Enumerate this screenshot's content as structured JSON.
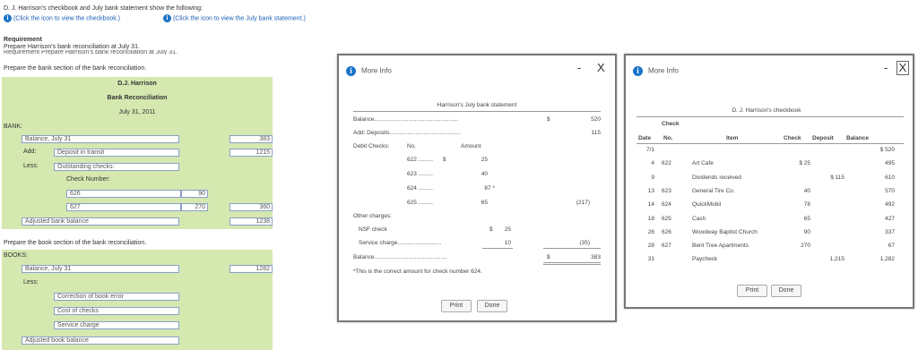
{
  "intro": {
    "line1": "D. J. Harrison's checkbook and July bank statement show the following:",
    "link1": "(Click the icon to view the checkbook.)",
    "link2": "(Click the icon to view the July bank statement.)",
    "req_label": "Requirement",
    "req_text": "Prepare Harrison's bank reconciliation at July 31.",
    "req_cut": "Requirement Prepare Harrison's bank reconciliation at July 31.",
    "bank_section_prompt": "Prepare the bank section of the bank reconciliation.",
    "book_section_prompt": "Prepare the book section of the bank reconciliation."
  },
  "worksheet": {
    "company": "D.J. Harrison",
    "title": "Bank Reconciliation",
    "date": "July 31, 2011",
    "bank_label": "BANK:",
    "balance_label": "Balance, July 31",
    "balance_value": "383",
    "add_label": "Add:",
    "deposit_label": "Deposit in transit",
    "deposit_value": "1215",
    "less_label": "Less:",
    "outstanding_label": "Outstanding checks:",
    "check_number_label": "Check Number:",
    "checks": [
      {
        "number": "626",
        "amount": "90"
      },
      {
        "number": "627",
        "amount": "270"
      }
    ],
    "checks_total": "360",
    "adjusted_bank_label": "Adjusted bank balance",
    "adjusted_bank_value": "1238",
    "books_label": "BOOKS:",
    "book_balance_label": "Balance, July 31",
    "book_balance_value": "1282",
    "book_less_label": "Less:",
    "book_less_items": [
      "Correction of book error",
      "Cost of checks",
      "Service charge"
    ],
    "adjusted_book_label": "Adjusted book balance"
  },
  "bank_window": {
    "title": "More Info",
    "minimize": "-",
    "close": "X",
    "statement_title": "Harrison's July bank statement",
    "balance_label": "Balance",
    "balance_currency": "$",
    "balance_value": "520",
    "deposits_label": "Add: Deposits",
    "deposits_value": "115",
    "debit_label": "Debit Checks:",
    "no_header": "No.",
    "amount_header": "Amount",
    "checks": [
      {
        "no": "622",
        "currency": "$",
        "amount": "25"
      },
      {
        "no": "623",
        "currency": "",
        "amount": "40"
      },
      {
        "no": "624",
        "currency": "",
        "amount": "87 *"
      },
      {
        "no": "625",
        "currency": "",
        "amount": "65"
      }
    ],
    "checks_total": "(217)",
    "other_label": "Other charges:",
    "nsf_label": "NSF check",
    "nsf_currency": "$",
    "nsf_value": "25",
    "service_label": "Service charge",
    "service_value": "10",
    "other_total": "(35)",
    "end_label": "Balance",
    "end_currency": "$",
    "end_value": "383",
    "footnote": "*This is the correct amount for check number 624.",
    "print": "Print",
    "done": "Done"
  },
  "check_window": {
    "title": "More Info",
    "minimize": "-",
    "close": "X",
    "table_title": "D. J. Harrison's checkbook",
    "check_header": "Check",
    "headers": [
      "Date",
      "No.",
      "Item",
      "Check",
      "Deposit",
      "Balance"
    ],
    "rows": [
      {
        "date": "7/1",
        "no": "",
        "item": "",
        "check": "",
        "deposit": "",
        "balance": "$     520"
      },
      {
        "date": "4",
        "no": "622",
        "item": "Art Cafe",
        "check": "$      25",
        "deposit": "",
        "balance": "495"
      },
      {
        "date": "9",
        "no": "",
        "item": "Dividends received",
        "check": "",
        "deposit": "$     115",
        "balance": "610"
      },
      {
        "date": "13",
        "no": "623",
        "item": "General Tire Co.",
        "check": "40",
        "deposit": "",
        "balance": "570"
      },
      {
        "date": "14",
        "no": "624",
        "item": "QuickMobil",
        "check": "78",
        "deposit": "",
        "balance": "492"
      },
      {
        "date": "18",
        "no": "625",
        "item": "Cash",
        "check": "65",
        "deposit": "",
        "balance": "427"
      },
      {
        "date": "26",
        "no": "626",
        "item": "Woodway Baptist Church",
        "check": "90",
        "deposit": "",
        "balance": "337"
      },
      {
        "date": "28",
        "no": "627",
        "item": "Bent Tree Apartments",
        "check": "270",
        "deposit": "",
        "balance": "67"
      },
      {
        "date": "31",
        "no": "",
        "item": "Paycheck",
        "check": "",
        "deposit": "1,215",
        "balance": "1,282"
      }
    ],
    "print": "Print",
    "done": "Done"
  }
}
